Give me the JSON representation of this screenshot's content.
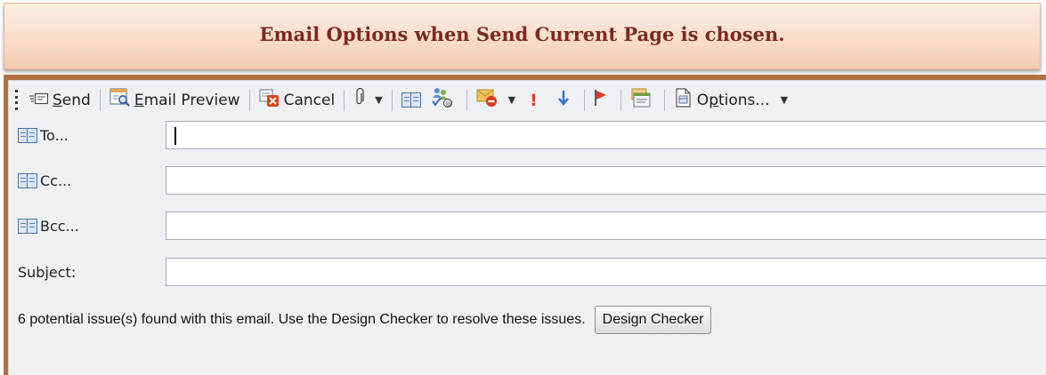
{
  "banner": {
    "title": "Email Options when Send Current Page is chosen."
  },
  "toolbar": {
    "send": {
      "mnemonic": "S",
      "rest": "end"
    },
    "email_preview": {
      "mnemonic": "E",
      "rest": "mail Preview"
    },
    "cancel": "Cancel",
    "exclamation": "!",
    "options": {
      "pre": "O",
      "mnemonic": "p",
      "rest": "tions..."
    }
  },
  "fields": {
    "to": {
      "label": "To...",
      "value": ""
    },
    "cc": {
      "label": "Cc...",
      "value": ""
    },
    "bcc": {
      "label": "Bcc...",
      "value": ""
    },
    "subject": {
      "label": "Subject:",
      "value": ""
    }
  },
  "status": {
    "message": "6 potential issue(s) found with this email. Use the Design Checker to resolve these issues.",
    "button": "Design Checker"
  },
  "colors": {
    "frame": "#b27247",
    "banner_text": "#7a2a22",
    "importance_high": "#e03b24",
    "importance_low": "#2f6fd6"
  }
}
